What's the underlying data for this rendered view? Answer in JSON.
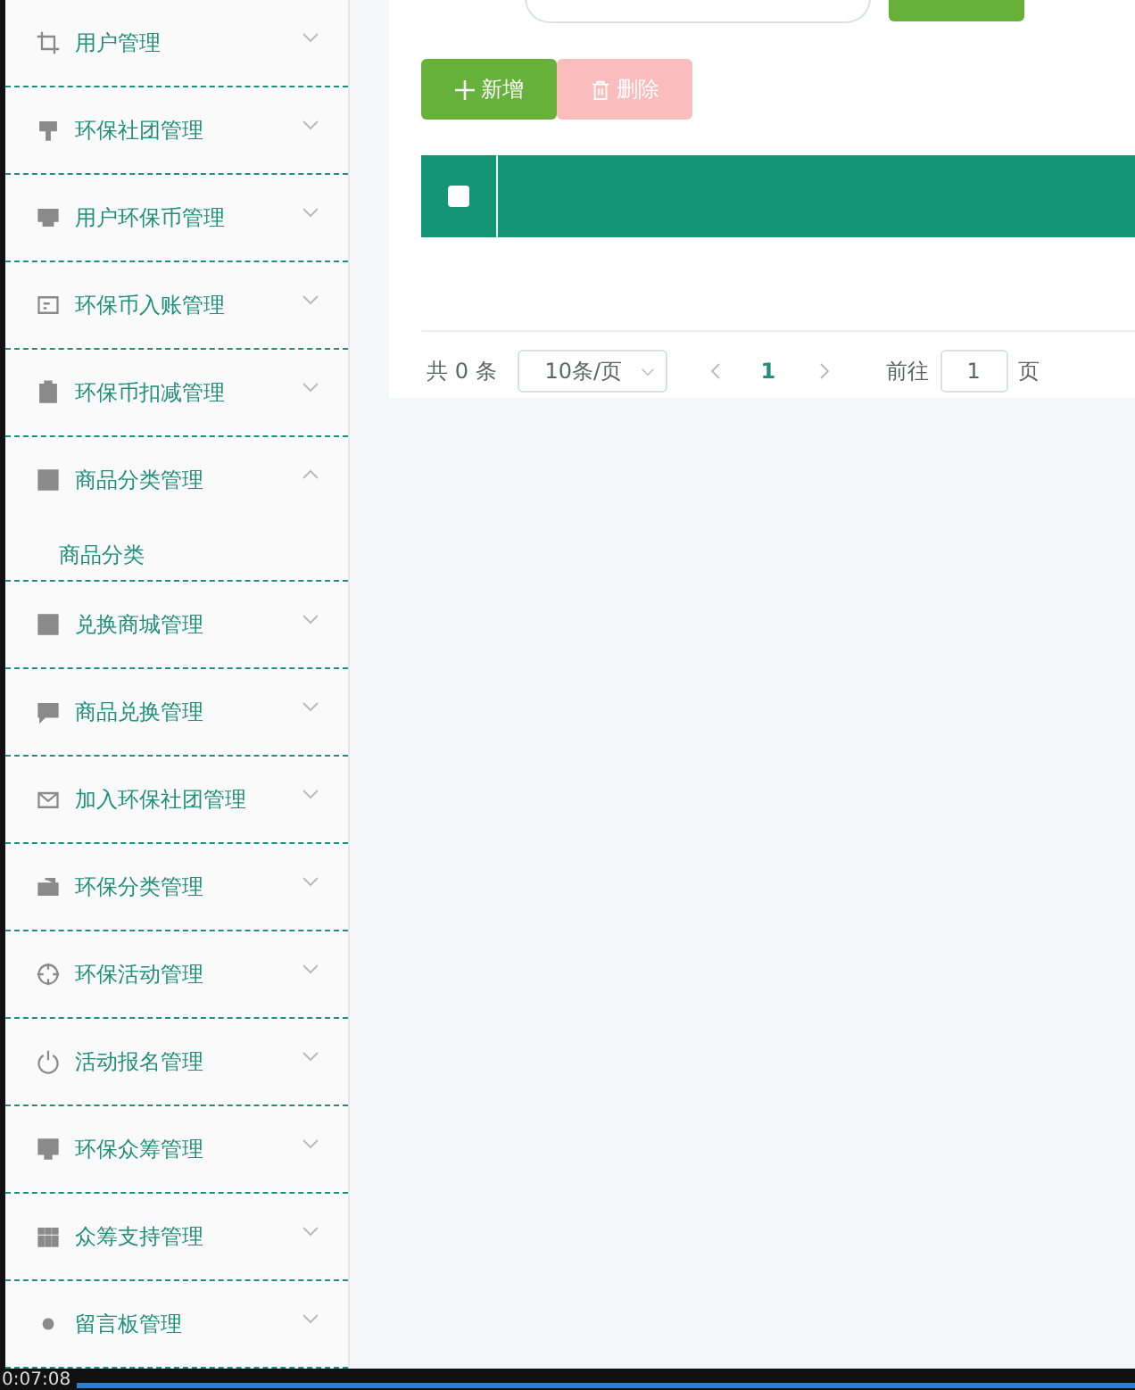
{
  "sidebar": {
    "items": [
      {
        "label": "用户管理",
        "expanded": false
      },
      {
        "label": "环保社团管理",
        "expanded": false
      },
      {
        "label": "用户环保币管理",
        "expanded": false
      },
      {
        "label": "环保币入账管理",
        "expanded": false
      },
      {
        "label": "环保币扣减管理",
        "expanded": false
      },
      {
        "label": "商品分类管理",
        "expanded": true,
        "children": [
          {
            "label": "商品分类"
          }
        ]
      },
      {
        "label": "兑换商城管理",
        "expanded": false
      },
      {
        "label": "商品兑换管理",
        "expanded": false
      },
      {
        "label": "加入环保社团管理",
        "expanded": false
      },
      {
        "label": "环保分类管理",
        "expanded": false
      },
      {
        "label": "环保活动管理",
        "expanded": false
      },
      {
        "label": "活动报名管理",
        "expanded": false
      },
      {
        "label": "环保众筹管理",
        "expanded": false
      },
      {
        "label": "众筹支持管理",
        "expanded": false
      },
      {
        "label": "留言板管理",
        "expanded": false
      }
    ]
  },
  "toolbar": {
    "add_button": {
      "label": "新增",
      "disabled": false
    },
    "delete_button": {
      "label": "删除",
      "disabled": true
    }
  },
  "table": {
    "select_all": {
      "checked": false
    }
  },
  "pagination": {
    "total": "共 0 条",
    "page_size": "10条/页",
    "pages": [
      {
        "label": "1",
        "selected": true
      }
    ],
    "goto_label": "前往",
    "goto_value": "1",
    "page_unit": "页"
  },
  "player": {
    "time": "0:07:08",
    "level": 1
  }
}
